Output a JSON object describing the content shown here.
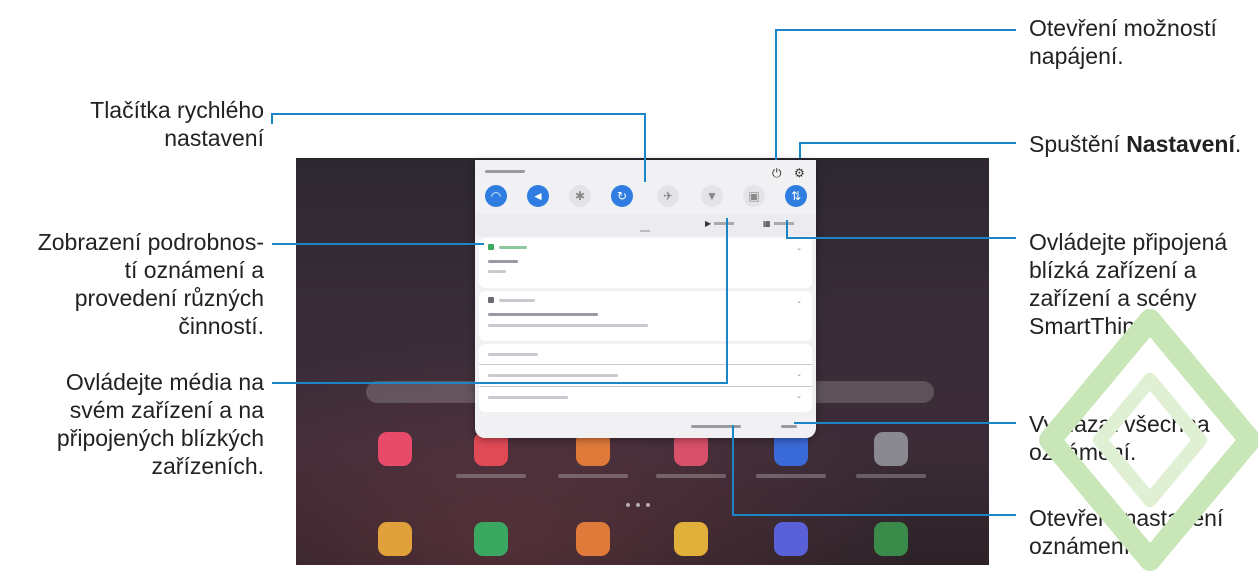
{
  "callouts": {
    "quick_settings": [
      "Tlačítka rychlého",
      "nastavení"
    ],
    "notification_details": [
      "Zobrazení podrobnos-",
      "tí oznámení a",
      "provedení různých",
      "činností."
    ],
    "media": [
      "Ovládejte média na",
      "svém zařízení a na",
      "připojených blízkých",
      "zařízeních."
    ],
    "power_options": [
      "Otevření možností",
      "napájení."
    ],
    "settings_prefix": "Spuštění ",
    "settings_bold": "Nastavení",
    "settings_suffix": ".",
    "devices": [
      "Ovládejte připojená",
      "blízká zařízení a",
      "zařízení a scény",
      "SmartThings."
    ],
    "clear_all": [
      "Vymazat všechna",
      "oznámení."
    ],
    "notification_settings": [
      "Otevření nastavení",
      "oznámení."
    ]
  },
  "colors": {
    "callout_line": "#1a86c8",
    "accent": "#2f7de0",
    "watermark": "#c8e6b8"
  },
  "icons": {
    "quick_buttons": [
      "wifi-icon",
      "sound-icon",
      "bluetooth-icon",
      "auto-rotate-icon",
      "airplane-icon",
      "flashlight-icon",
      "power-saving-icon",
      "mobile-data-icon"
    ],
    "power": "power-icon",
    "settings": "gear-icon",
    "media": "play-icon",
    "devices": "grid-icon"
  }
}
